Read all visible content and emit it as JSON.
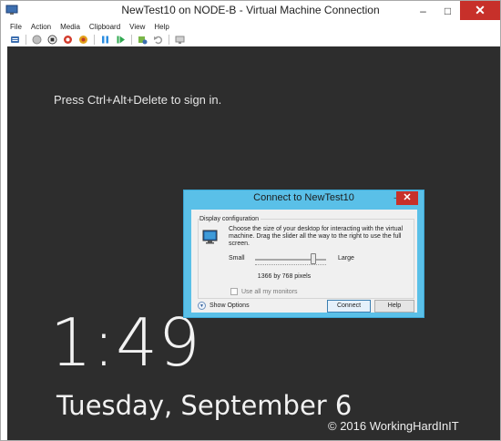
{
  "window": {
    "title": "NewTest10 on NODE-B - Virtual Machine Connection",
    "minimize": "–",
    "maximize": "□",
    "close": "✕"
  },
  "menu": [
    "File",
    "Action",
    "Media",
    "Clipboard",
    "View",
    "Help"
  ],
  "toolbar": {
    "icons": [
      "ctrl-alt-del-icon",
      "start-icon",
      "turn-off-icon",
      "shut-down-icon",
      "save-icon",
      "pause-icon",
      "reset-icon",
      "checkpoint-icon",
      "revert-icon",
      "enhanced-session-icon"
    ]
  },
  "screen": {
    "signin_text": "Press Ctrl+Alt+Delete to sign in.",
    "time": "1:49",
    "date": "Tuesday, September 6",
    "copyright": "© 2016 WorkingHardInIT"
  },
  "dialog": {
    "title": "Connect to NewTest10",
    "close": "✕",
    "minimize": "–",
    "group_label": "Display configuration",
    "description": "Choose the size of your desktop for interacting with the virtual machine. Drag the slider all the way to the right to use the full screen.",
    "slider_small": "Small",
    "slider_large": "Large",
    "slider_level": 0.82,
    "resolution": "1366 by 768 pixels",
    "use_all_monitors": "Use all my monitors",
    "use_all_monitors_checked": false,
    "show_options": "Show Options",
    "connect": "Connect",
    "help": "Help"
  },
  "colors": {
    "dialog_frame": "#5ac0e8",
    "close_button": "#c7302a",
    "screen_bg": "#2d2d2d"
  }
}
